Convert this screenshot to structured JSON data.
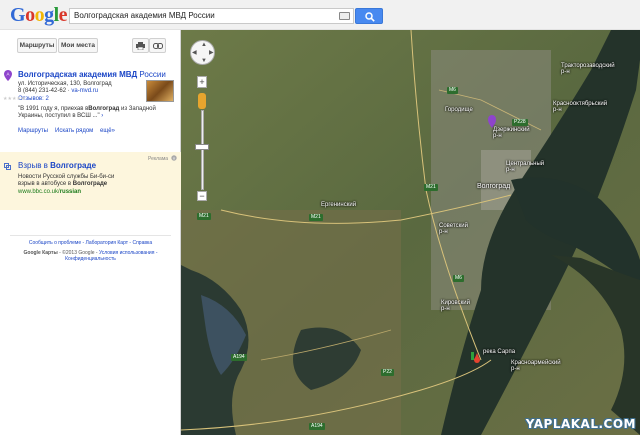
{
  "header": {
    "logo": {
      "g1": "G",
      "o1": "o",
      "o2": "o",
      "g2": "g",
      "l": "l",
      "e": "e"
    },
    "search_value": "Волгоградская академия МВД России"
  },
  "sidebar": {
    "routes_label": "Маршруты",
    "my_places_label": "Мои места",
    "result": {
      "marker": "A",
      "title_bold": "Волгоградская академия МВД",
      "title_rest": " России",
      "address": "ул. Историческая, 130, Волгоград",
      "phone": "8 (844) 231-42-62",
      "site": "va-mvd.ru",
      "reviews": "Отзывов: 2",
      "rating_stars": "★★★★★",
      "snippet_line1": "\"В 1991 году я, приехав в",
      "snippet_bold1": "Волгоград",
      "snippet_line1b": " из Западной",
      "snippet_line2": "Украины, поступил в ВСШ ...\"",
      "snippet_more": "›",
      "action_routes": "Маршруты",
      "action_nearby": "Искать рядом",
      "action_more": "ещё»"
    },
    "ad": {
      "badge": "Реклама",
      "title_pre": "Взрыв в ",
      "title_bold": "Волгограде",
      "desc_line1": "Новости Русской службы Би-би-си",
      "desc_line2_pre": "взрыв в автобусе в ",
      "desc_line2_bold": "Волгограде",
      "url_pre": "www.bbc.co.uk/",
      "url_bold": "russian"
    },
    "footer": {
      "line1": "Сообщить о проблеме - Лаборатория Карт - Справка",
      "line2a": "Google Карты",
      "line2b": "- ©2013 Google -",
      "line2c": "Условия использования -",
      "line3": "Конфиденциальность"
    }
  },
  "map": {
    "labels": {
      "gorodishche": "Городище",
      "dzerzhinsky": "Дзержинский\nр-н",
      "traktorozavodsky": "Тракторозаводский\nр-н",
      "krasnooktyabrsky": "Краснооктябрьский\nр-н",
      "tsentralny": "Центральный\nр-н",
      "volgograd": "Волгоград",
      "sovetsky": "Советский\nр-н",
      "kirovsky": "Кировский\nр-н",
      "krasnoarmeysky": "Красноармейский\nр-н",
      "yergeninsky": "Ергенинский",
      "piesegka": "река Сарпа"
    },
    "roads": [
      "M6",
      "P228",
      "M21",
      "M21",
      "M21",
      "M6",
      "A194",
      "A194",
      "Р22"
    ],
    "watermark": "YAPLAKAL.COM"
  }
}
